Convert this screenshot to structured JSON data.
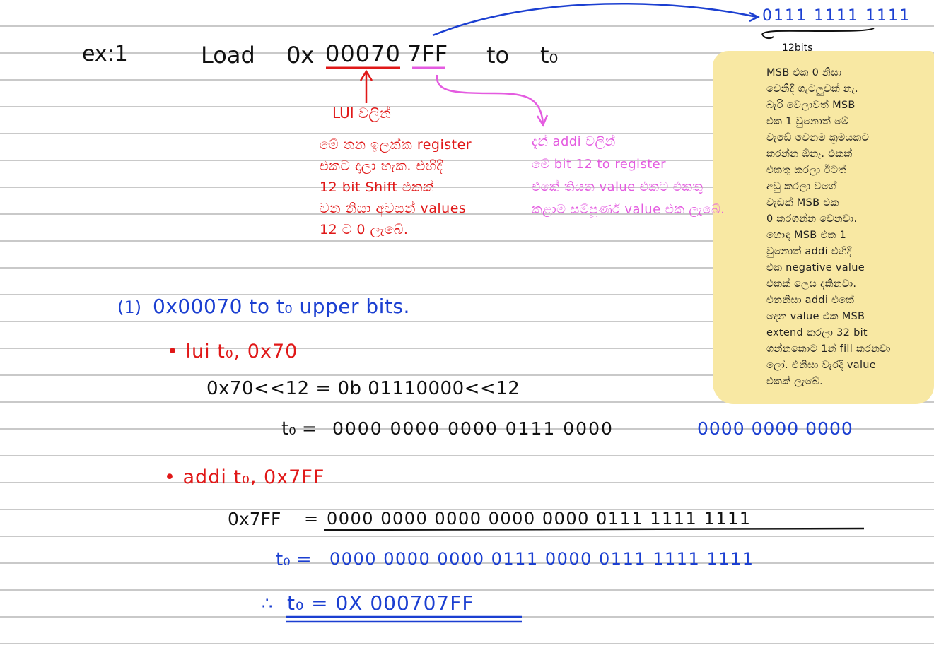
{
  "header": {
    "label": "ex:1",
    "load": "Load",
    "hex_prefix": "0x",
    "hex_upper": "00070",
    "hex_lower": "7FF",
    "to": "to",
    "reg": "t₀",
    "bits_top": "0111  1111  1111",
    "bits_caption": "12bits"
  },
  "annotations": {
    "lui_title": "LUI වලින්",
    "lui_lines": [
      "මේ තන ඉලක්ක register",
      "එකට දාලා හැක. එහිදී",
      "12 bit  Shift එකක්",
      "වන නිසා අවසන් values",
      "12 ට  0 ලැබේ."
    ],
    "addi_lines": [
      "දැන් addi වලින්",
      "මේ bit 12 to register",
      "එකේ තියන value එකට එකතු",
      "කළාම සම්පූර්ණ value එක ලැබේ."
    ]
  },
  "note": {
    "lines": [
      "MSB එක 0 නිසා",
      "වෙනිදි ගැටලුවක් නැ.",
      "බැරි වෙලාවත් MSB",
      "එක 1 වුනොත් මේ",
      "වැඩේ වෙනම ක්‍රමයකට",
      "කරන්න ඕනෑ. එකක්",
      "එකතු කරලා ඊටත්",
      "අඩු කරලා වගේ",
      "වැඩක් MSB එක",
      "0 කරගන්න වෙනවා.",
      "හොඳ MSB එක 1",
      "වුනොත් addi එහිදී",
      "එක negative value",
      "එකක් ලෙස දකිනවා.",
      "එනනිසා addi එකේ",
      "දෙන value එක MSB",
      "extend කරලා 32 bit",
      "ගන්නකොට 1න් fill කරනවා",
      "ලෝ. එනිසා වැරදි value",
      "එකක් ලැබේ."
    ]
  },
  "step1": {
    "num": "(1)",
    "text": "0x00070   to   t₀  upper bits.",
    "lui_instr": "• lui  t₀, 0x70",
    "shift": "0x70<<12 = 0b 01110000<<12",
    "t0_label": "t₀ = ",
    "t0_black": "0000 0000   0000   0111  0000",
    "t0_blue": "0000 0000 0000"
  },
  "step2": {
    "addi_instr": "• addi  t₀, 0x7FF",
    "imm_label": "0x7FF",
    "eq": "=",
    "imm_bits": "0000 0000   0000  0000 0000 0111   1111   1111",
    "t0_label": "t₀ =",
    "t0_bits": "0000 0000   0000  0111 0000 0111   1111   1111"
  },
  "result": {
    "therefore": "∴",
    "text": "t₀ = 0X 000707FF"
  }
}
